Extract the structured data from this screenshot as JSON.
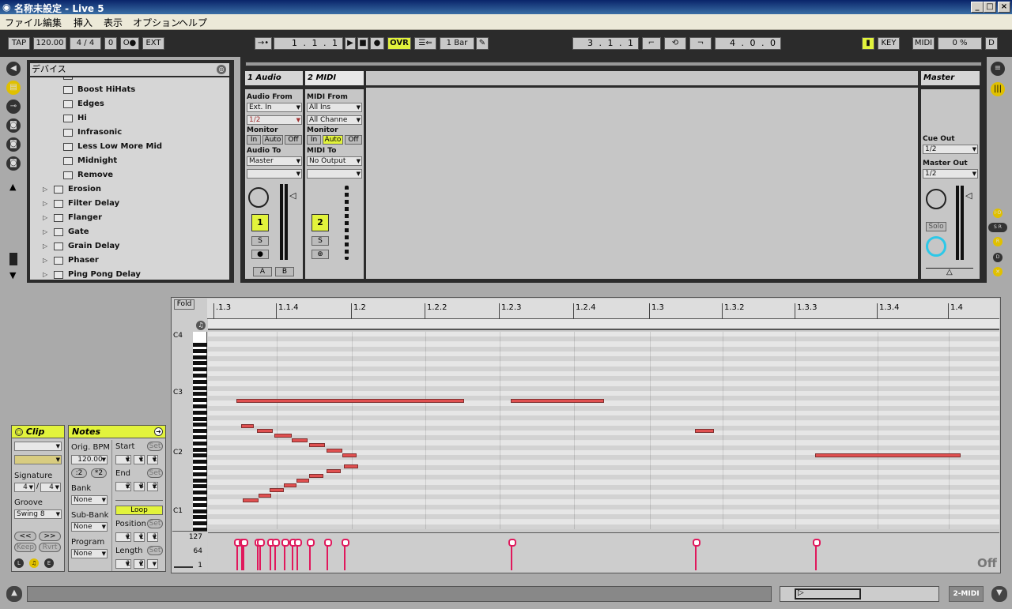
{
  "window": {
    "title": "名称未設定 - Live 5",
    "min": "_",
    "max": "□",
    "close": "×"
  },
  "menu": [
    "ファイル",
    "編集",
    "挿入",
    "表示",
    "オプション",
    "ヘルプ"
  ],
  "transport": {
    "tap": "TAP",
    "bpm": "120.00",
    "sig": "4 / 4",
    "groove": "0",
    "metro": "O●",
    "ext": "EXT",
    "follow": "→•",
    "position": "1 . 1 . 1",
    "ovr": "OVR",
    "quant": "1 Bar",
    "loop_start": "3 . 1 . 1",
    "loop_length": "4 . 0 . 0",
    "key": "KEY",
    "midi": "MIDI",
    "cpu": "0 %",
    "disk": "D"
  },
  "browser": {
    "title": "デバイス",
    "items": [
      {
        "label": "Boost HiHats",
        "depth": 2
      },
      {
        "label": "Edges",
        "depth": 2
      },
      {
        "label": "Hi",
        "depth": 2
      },
      {
        "label": "Infrasonic",
        "depth": 2
      },
      {
        "label": "Less Low More Mid",
        "depth": 2
      },
      {
        "label": "Midnight",
        "depth": 2
      },
      {
        "label": "Remove",
        "depth": 2
      },
      {
        "label": "Erosion",
        "depth": 1
      },
      {
        "label": "Filter Delay",
        "depth": 1
      },
      {
        "label": "Flanger",
        "depth": 1
      },
      {
        "label": "Gate",
        "depth": 1
      },
      {
        "label": "Grain Delay",
        "depth": 1
      },
      {
        "label": "Phaser",
        "depth": 1
      },
      {
        "label": "Ping Pong Delay",
        "depth": 1
      }
    ]
  },
  "tracks": [
    {
      "name": "1 Audio",
      "from_label": "Audio From",
      "from": "Ext. In",
      "from_sub": "1/2",
      "monitor": "Monitor",
      "to_label": "Audio To",
      "to": "Master",
      "num": "1",
      "solo": "S",
      "arm": "●",
      "a": "A",
      "b": "B"
    },
    {
      "name": "2 MIDI",
      "from_label": "MIDI From",
      "from": "All Ins",
      "from_sub": "All Channe",
      "monitor": "Monitor",
      "to_label": "MIDI To",
      "to": "No Output",
      "num": "2",
      "solo": "S",
      "arm": "⊕"
    }
  ],
  "monitor_opts": [
    "In",
    "Auto",
    "Off"
  ],
  "master": {
    "name": "Master",
    "cue_label": "Cue Out",
    "cue": "1/2",
    "out_label": "Master Out",
    "out": "1/2",
    "solo": "Solo"
  },
  "clip": {
    "title": "Clip",
    "sig_label": "Signature",
    "sig_num": "4",
    "sig_den": "4",
    "sig_sep": "/",
    "groove_label": "Groove",
    "groove": "Swing 8",
    "prev": "<<",
    "next": ">>",
    "keep": "Keep",
    "rvrt": "Rvrt",
    "L": "L",
    "E": "E"
  },
  "notes": {
    "title": "Notes",
    "bpm_label": "Orig. BPM",
    "bpm": "120.00",
    "half": ":2",
    "dbl": "*2",
    "bank_label": "Bank",
    "bank": "None",
    "subbank_label": "Sub-Bank",
    "subbank": "None",
    "program_label": "Program",
    "program": "None",
    "start_label": "Start",
    "start": [
      "1",
      "1",
      "1"
    ],
    "end_label": "End",
    "end": [
      "2",
      "3",
      "2"
    ],
    "set": "Set",
    "loop": "Loop",
    "pos_label": "Position",
    "pos": [
      "1",
      "1",
      "1"
    ],
    "len_label": "Length",
    "len": [
      "1",
      "2",
      ""
    ]
  },
  "editor": {
    "fold": "Fold",
    "ruler": [
      ".1.3",
      "1.1.4",
      "1.2",
      "1.2.2",
      "1.2.3",
      "1.2.4",
      "1.3",
      "1.3.2",
      "1.3.3",
      "1.3.4",
      "1.4"
    ],
    "octaves": [
      "C4",
      "C3",
      "C2",
      "C1"
    ],
    "velo_labels": [
      "127",
      "64",
      "1"
    ],
    "off": "Off"
  },
  "status": {
    "track": "2-MIDI"
  }
}
